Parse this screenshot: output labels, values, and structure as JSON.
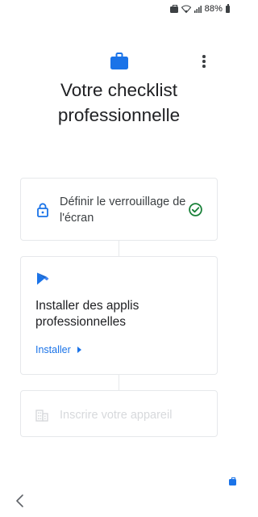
{
  "status_bar": {
    "battery_text": "88%",
    "icons": [
      "work-profile-briefcase-icon",
      "wifi-icon",
      "signal-icon",
      "battery-icon"
    ]
  },
  "header": {
    "icon": "briefcase-icon",
    "menu_icon": "more-vert-icon",
    "title": "Votre checklist professionnelle"
  },
  "checklist": {
    "lock_screen": {
      "label": "Définir le verrouillage de l'écran",
      "icon": "lock-icon",
      "status_icon": "check-circle-icon",
      "status": "done"
    },
    "apps": {
      "label": "Installer des applis professionnelles",
      "icon": "play-store-icon",
      "action_label": "Installer"
    },
    "enroll": {
      "label": "Inscrire votre appareil",
      "icon": "building-icon",
      "status": "disabled"
    }
  },
  "colors": {
    "accent": "#1a73e8",
    "success": "#188038",
    "card_border": "#e6e8eb",
    "disabled_text": "#d7d9dc"
  },
  "navigation": {
    "back_icon": "back-chevron-icon"
  }
}
